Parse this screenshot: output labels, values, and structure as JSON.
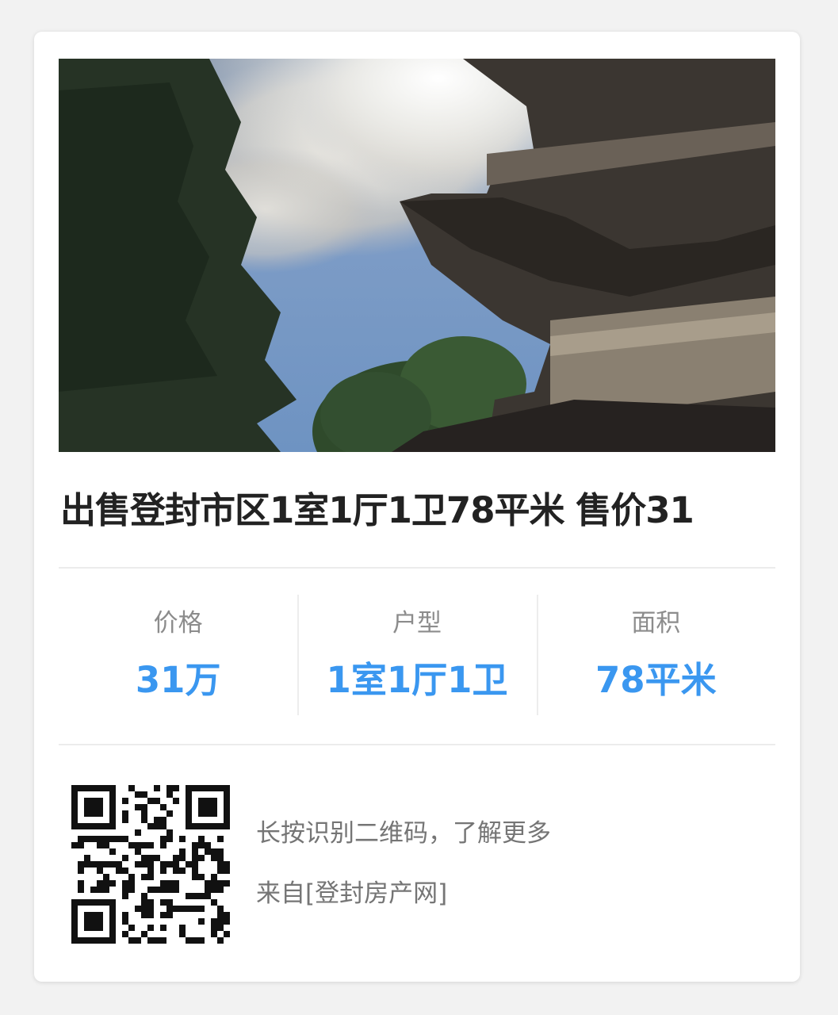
{
  "listing": {
    "title": "出售登封市区1室1厅1卫78平米 售价31"
  },
  "stats": [
    {
      "label": "价格",
      "value": "31万"
    },
    {
      "label": "户型",
      "value": "1室1厅1卫"
    },
    {
      "label": "面积",
      "value": "78平米"
    }
  ],
  "footer": {
    "qr_hint": "长按识别二维码，了解更多",
    "source": "来自[登封房产网]"
  },
  "colors": {
    "accent": "#3a97f0",
    "title": "#222222",
    "muted": "#8c8c8c"
  }
}
